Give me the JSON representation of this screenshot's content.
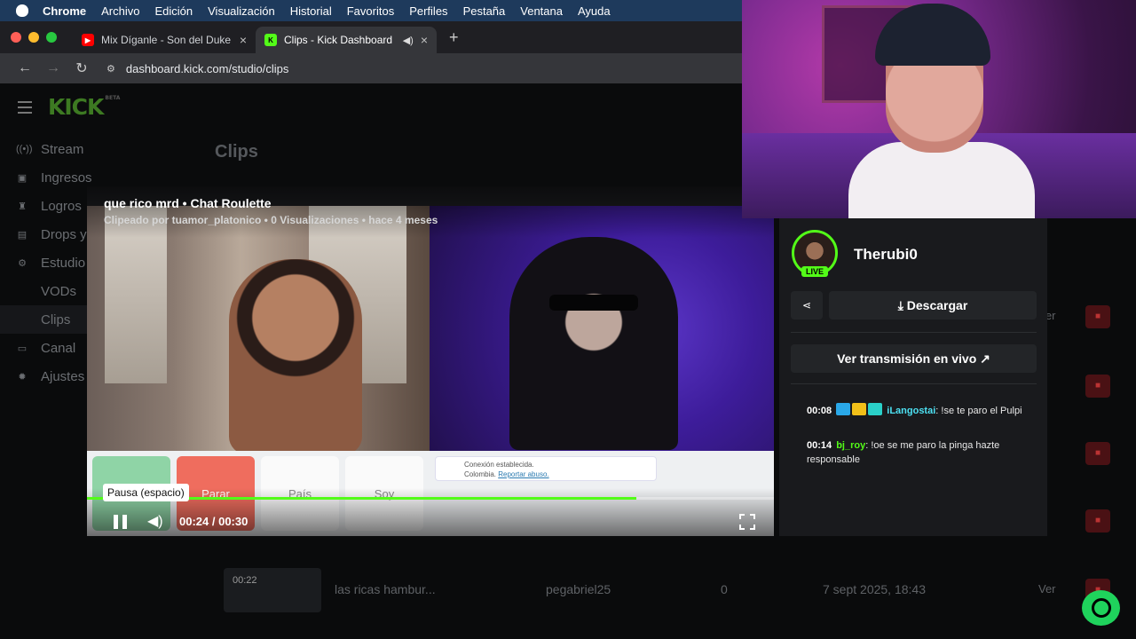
{
  "menubar": {
    "app": "Chrome",
    "items": [
      "Archivo",
      "Edición",
      "Visualización",
      "Historial",
      "Favoritos",
      "Perfiles",
      "Pestaña",
      "Ventana",
      "Ayuda"
    ]
  },
  "browser": {
    "tabs": [
      {
        "title": "Mix Díganle - Son del Duke -",
        "icon": "youtube-icon",
        "active": false
      },
      {
        "title": "Clips - Kick Dashboard",
        "icon": "kick-icon",
        "active": true
      }
    ],
    "url": "dashboard.kick.com/studio/clips"
  },
  "sidebar": {
    "logo": "KICK",
    "logo_badge": "BETA",
    "items": [
      {
        "label": "Stream",
        "icon": "broadcast-icon"
      },
      {
        "label": "Ingresos",
        "icon": "money-icon"
      },
      {
        "label": "Logros",
        "icon": "trophy-icon"
      },
      {
        "label": "Drops y",
        "icon": "drop-icon"
      },
      {
        "label": "Estudio",
        "icon": "studio-icon"
      },
      {
        "label": "VODs",
        "icon": ""
      },
      {
        "label": "Clips",
        "icon": ""
      },
      {
        "label": "Canal",
        "icon": "channel-icon"
      },
      {
        "label": "Ajustes",
        "icon": "gear-icon"
      }
    ]
  },
  "page": {
    "title": "Clips"
  },
  "table": {
    "rows": [
      {
        "duration": "00:22",
        "title": "las ricas hambur...",
        "creator": "pegabriel25",
        "views": "0",
        "date": "7 sept 2025, 18:43",
        "action": "Ver"
      }
    ],
    "partial_action": "Ver"
  },
  "player": {
    "title": "que rico mrd • Chat Roulette",
    "meta": "Clipeado por tuamor_platonico • 0 Visualizaciones • hace 4 meses",
    "tooltip": "Pausa (espacio)",
    "time": "00:24 / 00:30",
    "progress": 0.8,
    "cards": [
      "Parar",
      "País",
      "Soy"
    ],
    "connection": "Conexión establecida.",
    "country": "Colombia.",
    "report": "Reportar abuso."
  },
  "panel": {
    "streamer": "Therubi0",
    "live_badge": "LIVE",
    "download_label": "Descargar",
    "live_label": "Ver transmisión en vivo",
    "chat": [
      {
        "time": "00:08",
        "user": "iLangostai",
        "message": "!se te paro el Pulpi"
      },
      {
        "time": "00:14",
        "user": "bj_roy",
        "message": "!oe se me paro la pinga hazte responsable"
      }
    ]
  },
  "colors": {
    "kick_green": "#53fc18",
    "menubar": "#1e3a5c",
    "danger": "#4a1114"
  }
}
